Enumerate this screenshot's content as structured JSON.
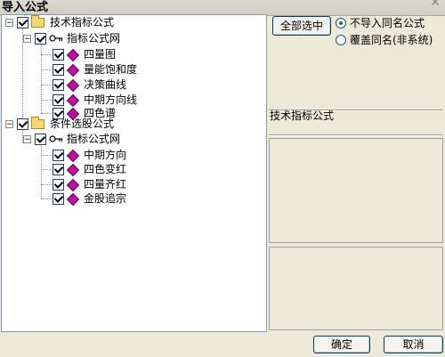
{
  "window": {
    "title": "导入公式"
  },
  "tree": [
    {
      "label": "技术指标公式",
      "type": "folder",
      "checked": true,
      "expanded": true
    },
    {
      "label": "指标公式网",
      "type": "key",
      "checked": true,
      "expanded": true
    },
    {
      "label": "四量图",
      "type": "formula",
      "checked": true
    },
    {
      "label": "量能饱和度",
      "type": "formula",
      "checked": true
    },
    {
      "label": "决策曲线",
      "type": "formula",
      "checked": true
    },
    {
      "label": "中期方向线",
      "type": "formula",
      "checked": true
    },
    {
      "label": "四色谱",
      "type": "formula",
      "checked": true
    },
    {
      "label": "条件选股公式",
      "type": "folder",
      "checked": true,
      "expanded": true
    },
    {
      "label": "指标公式网",
      "type": "key",
      "checked": true,
      "expanded": true
    },
    {
      "label": "中期方向",
      "type": "formula",
      "checked": true
    },
    {
      "label": "四色变红",
      "type": "formula",
      "checked": true
    },
    {
      "label": "四量齐红",
      "type": "formula",
      "checked": true
    },
    {
      "label": "金股追宗",
      "type": "formula",
      "checked": true
    }
  ],
  "expander_symbol": "−",
  "select_all_button": "全部选中",
  "radios": [
    {
      "label": "不导入同名公式",
      "checked": true
    },
    {
      "label": "覆盖同名(非系统)",
      "checked": false
    }
  ],
  "info_label": "技术指标公式",
  "ok_button": "确定",
  "cancel_button": "取消",
  "close_glyph": "✕"
}
